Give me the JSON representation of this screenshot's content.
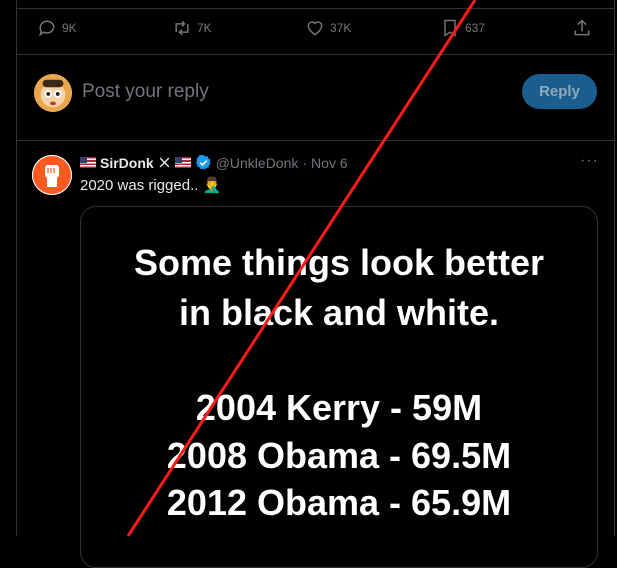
{
  "actions": {
    "replies": "9K",
    "reposts": "7K",
    "likes": "37K",
    "bookmarks": "637"
  },
  "reply_box": {
    "placeholder": "Post your reply",
    "button": "Reply"
  },
  "tweet": {
    "display_name": "SirDonk",
    "handle": "@UnkleDonk",
    "separator": "·",
    "date": "Nov 6",
    "text": "2020 was rigged..",
    "emoji": "🤦‍♂️",
    "more": "···",
    "image_lines": [
      "Some things look better",
      "in black and white.",
      "2004 Kerry - 59M",
      "2008 Obama - 69.5M",
      "2012 Obama - 65.9M"
    ]
  },
  "colors": {
    "background": "#000000",
    "muted": "#71767b",
    "border": "#2f3336",
    "reply_button": "#1a5d8f",
    "verified": "#1d9bf0",
    "annotation": "#ff1a1a"
  }
}
